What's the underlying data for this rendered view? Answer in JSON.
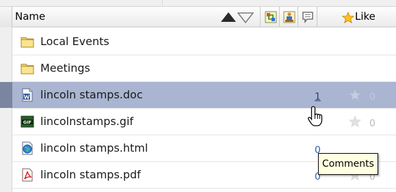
{
  "header": {
    "name_label": "Name",
    "like_label": "Like"
  },
  "rows": [
    {
      "name": "Local Events",
      "icon": "folder-icon"
    },
    {
      "name": "Meetings",
      "icon": "folder-icon"
    },
    {
      "name": "lincoln stamps.doc",
      "icon": "word-doc-icon",
      "comments": "1",
      "likes": "0",
      "selected": true
    },
    {
      "name": "lincolnstamps.gif",
      "icon": "gif-image-icon",
      "likes": "0"
    },
    {
      "name": "lincoln stamps.html",
      "icon": "html-page-icon",
      "comments": "0"
    },
    {
      "name": "lincoln stamps.pdf",
      "icon": "pdf-icon",
      "comments": "0",
      "likes": "0"
    }
  ],
  "tooltip": {
    "text": "Comments"
  },
  "colors": {
    "selection": "#a9b5d1",
    "tooltip_bg": "#ffffe1",
    "link": "#3060a8"
  }
}
